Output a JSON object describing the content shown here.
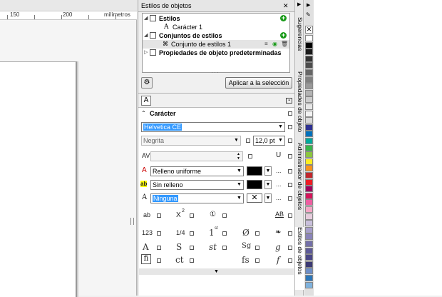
{
  "ruler": {
    "tick1": "150",
    "tick2": "200",
    "unit": "milímetros"
  },
  "docker": {
    "title": "Estilos de objetos",
    "tree": {
      "styles": "Estilos",
      "caracter1": "Carácter 1",
      "style_sets": "Conjuntos de estilos",
      "style_set1": "Conjunto de estilos 1",
      "defaults": "Propiedades de objeto predeterminadas"
    },
    "apply_button": "Aplicar a la selección",
    "section_title": "Carácter",
    "font_name": "Helvetica CE",
    "font_style": "Negrita",
    "font_size": "12,0 pt",
    "fill_type": "Relleno uniforme",
    "background_fill": "Sin relleno",
    "outline": "Ninguna",
    "ellipsis": "...",
    "glyphs": {
      "ab": "ab",
      "x2": "X",
      "sup": "2",
      "o1": "①",
      "ab2": "AB",
      "n123": "123",
      "quarter": "1/4",
      "first": "1",
      "st": "st",
      "zero": "Ø",
      "swash": "A",
      "s": "S",
      "dollar": "st",
      "sg": "Sg",
      "g": "g",
      "fi": "fi",
      "ct": "ct",
      "ss": "fs",
      "f": "f"
    }
  },
  "side_tabs": {
    "suggestions": "Sugerencias",
    "properties": "Propiedades de objeto",
    "manager": "Administrador de objetos",
    "styles": "Estilos de objetos"
  },
  "colors": {
    "highlight": "#3399ff",
    "add_green": "#1a9b1a",
    "palette": [
      "#ffffff",
      "#000000",
      "#1a1a1a",
      "#333333",
      "#4d4d4d",
      "#666666",
      "#808080",
      "#999999",
      "#b3b3b3",
      "#cccccc",
      "#e6e6e6",
      "#f2f2f2",
      "#d9d9d9",
      "#2e3192",
      "#0071bc",
      "#00a99d",
      "#39b54a",
      "#8cc63f",
      "#fcee21",
      "#f7931e",
      "#c1272d",
      "#ed1c24",
      "#9e005d",
      "#d4145a",
      "#ed5ea1",
      "#f4a6c6",
      "#e6ccdd",
      "#c9c0dc",
      "#a79fcb",
      "#8a83ba",
      "#736fa9",
      "#5d5a98",
      "#4a4786",
      "#3c3a74",
      "#6d8ec7",
      "#2b76b9",
      "#7fb2dd"
    ]
  }
}
